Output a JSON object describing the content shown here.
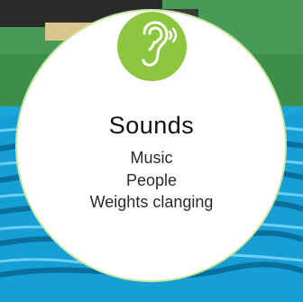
{
  "card": {
    "icon": "ear-listening-icon",
    "title": "Sounds",
    "items": [
      "Music",
      "People",
      "Weights clanging"
    ]
  },
  "colors": {
    "badge": "#8cc63f",
    "card": "#ffffff",
    "water": "#1aa6d9",
    "grass": "#3b8f4a"
  }
}
